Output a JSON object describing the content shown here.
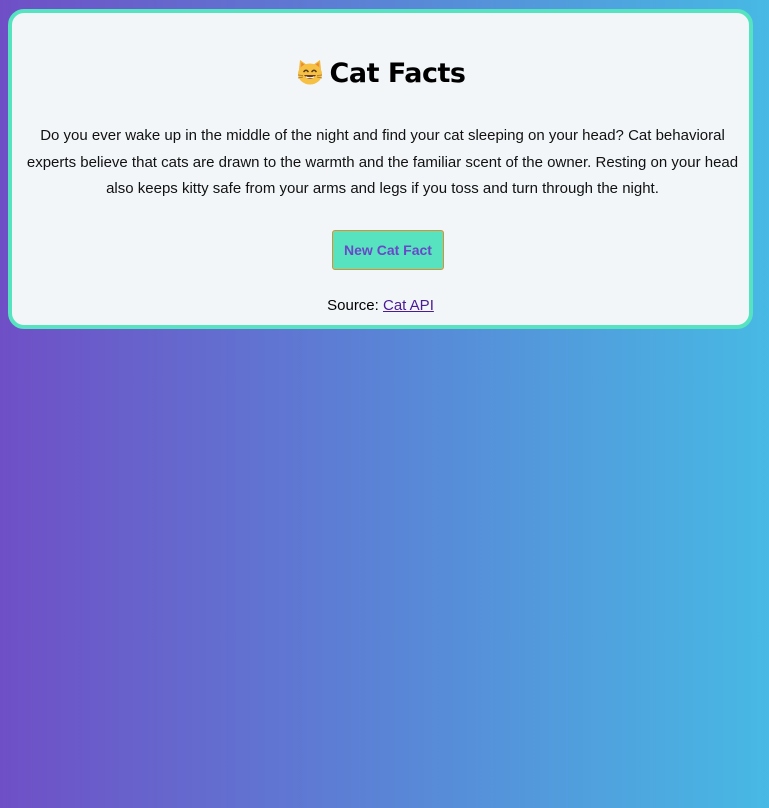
{
  "header": {
    "icon": "grinning-cat-emoji-icon",
    "title": "Cat Facts"
  },
  "fact": {
    "text": "Do you ever wake up in the middle of the night and find your cat sleeping on your head? Cat behavioral experts believe that cats are drawn to the warmth and the familiar scent of the owner. Resting on your head also keeps kitty safe from your arms and legs if you toss and turn through the night."
  },
  "button": {
    "label": "New Cat Fact"
  },
  "source": {
    "prefix": "Source:",
    "link_text": "Cat API"
  },
  "colors": {
    "gradient_start": "#6f4fc6",
    "gradient_end": "#47b9e4",
    "card_background": "#f2f6f9",
    "card_border": "#56e3c0",
    "button_background": "#58e3c0",
    "button_text": "#6a47c8",
    "button_border": "#e38d2a",
    "link": "#4b1a96"
  }
}
